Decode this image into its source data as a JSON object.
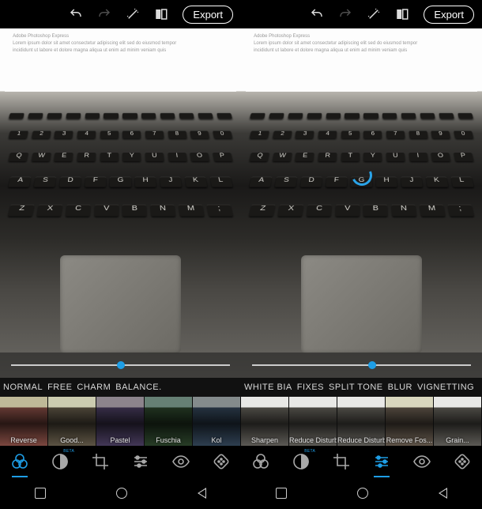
{
  "left": {
    "topbar": {
      "export_label": "Export"
    },
    "slider": {
      "value": 50
    },
    "modes": [
      "NORMAL",
      "FREE",
      "CHARM",
      "BALANCE."
    ],
    "thumbs": [
      {
        "label": "Reverse",
        "tint": "red"
      },
      {
        "label": "Good...",
        "tint": "sep"
      },
      {
        "label": "Pastel",
        "tint": "pur"
      },
      {
        "label": "Fuschia",
        "tint": "grn"
      },
      {
        "label": "Kol",
        "tint": "blu"
      }
    ],
    "tools": {
      "active_index": 0,
      "beta_label": "BETA"
    }
  },
  "right": {
    "topbar": {
      "export_label": "Export"
    },
    "slider": {
      "value": 55
    },
    "modes": [
      "WHITE BIA",
      "FIXES",
      "SPLIT TONE",
      "BLUR",
      "VIGNETTING"
    ],
    "thumbs": [
      {
        "label": "Sharpen",
        "tint": ""
      },
      {
        "label": "Reduce Disturb...",
        "tint": ""
      },
      {
        "label": "Reduce Disturb",
        "tint": ""
      },
      {
        "label": "Remove Fos...",
        "tint": "warm"
      },
      {
        "label": "Grain...",
        "tint": ""
      }
    ],
    "tools": {
      "active_index": 3,
      "beta_label": "BETA"
    },
    "loading": true
  },
  "icons": {
    "undo": "undo-icon",
    "redo": "redo-icon",
    "wand": "wand-icon",
    "compare": "compare-icon",
    "looks": "looks-icon",
    "adjust": "adjust-icon",
    "crop": "crop-icon",
    "sliders": "sliders-icon",
    "eye": "eye-icon",
    "patch": "patch-icon"
  }
}
